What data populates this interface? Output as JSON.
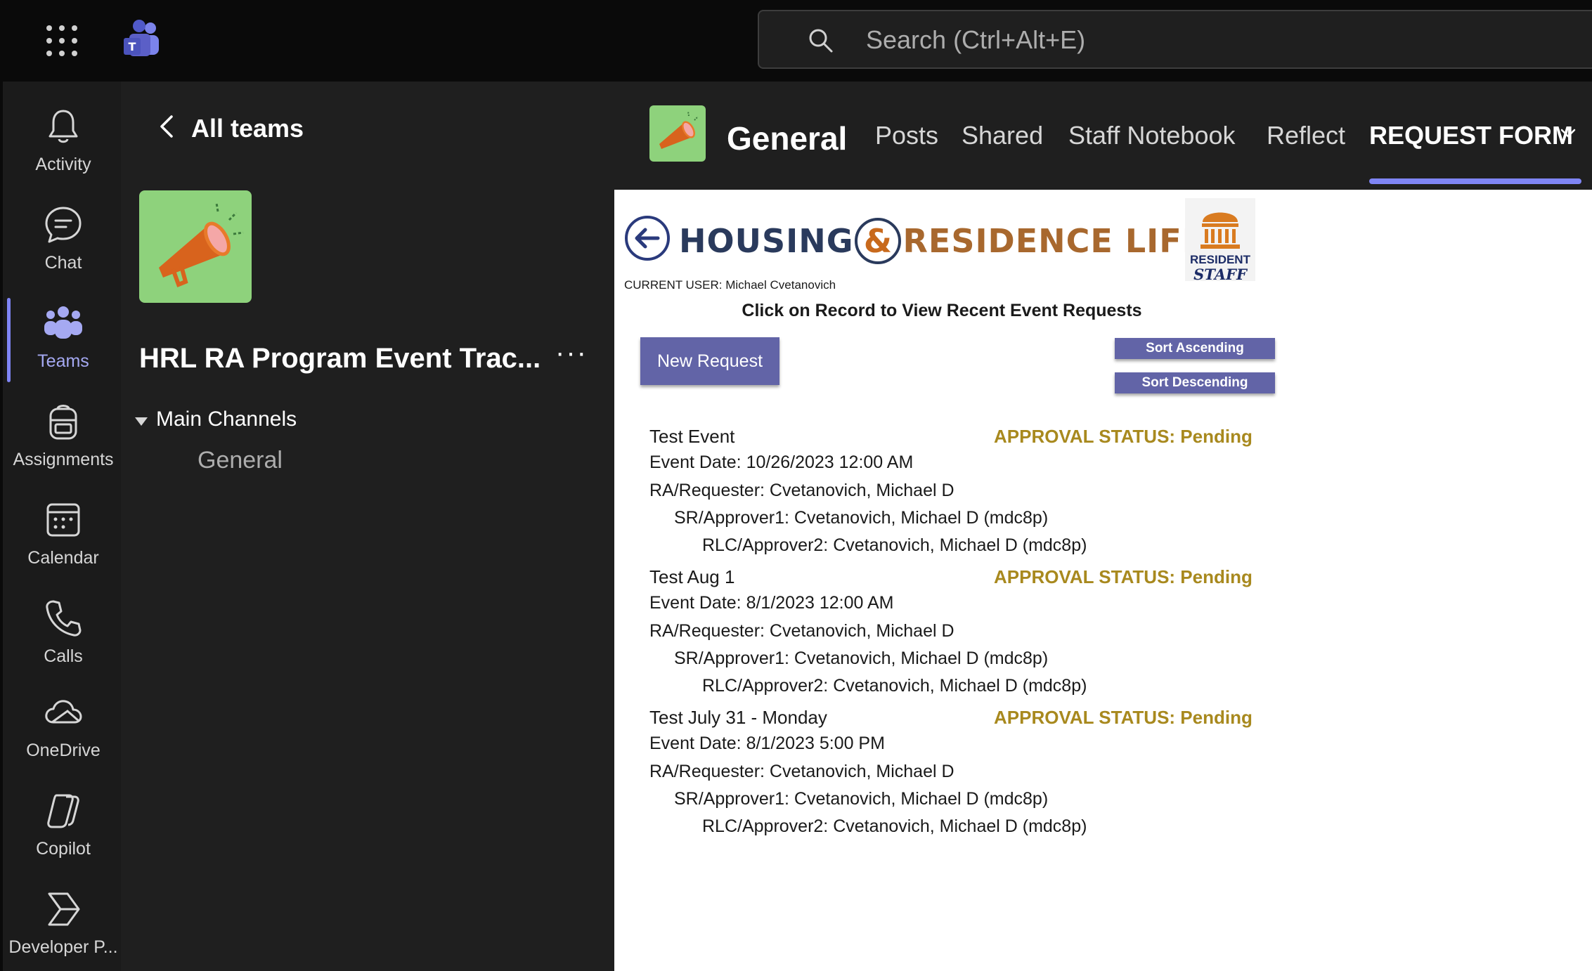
{
  "topbar": {
    "search_placeholder": "Search (Ctrl+Alt+E)"
  },
  "rail": {
    "items": [
      {
        "label": "Activity",
        "icon": "bell-icon"
      },
      {
        "label": "Chat",
        "icon": "chat-icon"
      },
      {
        "label": "Teams",
        "icon": "teams-icon",
        "active": true
      },
      {
        "label": "Assignments",
        "icon": "backpack-icon"
      },
      {
        "label": "Calendar",
        "icon": "calendar-icon"
      },
      {
        "label": "Calls",
        "icon": "phone-icon"
      },
      {
        "label": "OneDrive",
        "icon": "cloud-icon"
      },
      {
        "label": "Copilot",
        "icon": "copilot-icon"
      },
      {
        "label": "Developer P...",
        "icon": "developer-portal-icon"
      }
    ]
  },
  "panel": {
    "back_label": "All teams",
    "team_name": "HRL RA Program Event Trac...",
    "more_label": "···",
    "section_name": "Main Channels",
    "channel": "General"
  },
  "header": {
    "channel_title": "General",
    "tabs": [
      "Posts",
      "Shared",
      "Staff Notebook",
      "Reflect",
      "REQUEST FORM"
    ],
    "active_tab": "REQUEST FORM"
  },
  "app": {
    "banner_part1": "HOUSING",
    "banner_amp": "&",
    "banner_part2": "RESIDENCE LIFE",
    "logo_line1": "RESIDENT",
    "logo_line2": "STAFF",
    "current_user": "CURRENT USER: Michael Cvetanovich",
    "instructions": "Click on Record to View Recent Event Requests",
    "new_request_label": "New Request",
    "sort_ascending_label": "Sort Ascending",
    "sort_descending_label": "Sort Descending",
    "records": [
      {
        "name": "Test Event",
        "status": "APPROVAL STATUS: Pending",
        "event_date": "Event Date: 10/26/2023 12:00 AM",
        "requester": "RA/Requester: Cvetanovich, Michael D",
        "approver1": "SR/Approver1: Cvetanovich, Michael D (mdc8p)",
        "approver2": "RLC/Approver2: Cvetanovich, Michael D (mdc8p)"
      },
      {
        "name": "Test Aug 1",
        "status": "APPROVAL STATUS: Pending",
        "event_date": "Event Date: 8/1/2023 12:00 AM",
        "requester": "RA/Requester: Cvetanovich, Michael D",
        "approver1": "SR/Approver1: Cvetanovich, Michael D (mdc8p)",
        "approver2": "RLC/Approver2: Cvetanovich, Michael D (mdc8p)"
      },
      {
        "name": "Test July 31 - Monday",
        "status": "APPROVAL STATUS: Pending",
        "event_date": "Event Date: 8/1/2023 5:00 PM",
        "requester": "RA/Requester: Cvetanovich, Michael D",
        "approver1": "SR/Approver1: Cvetanovich, Michael D (mdc8p)",
        "approver2": "RLC/Approver2: Cvetanovich, Michael D (mdc8p)"
      }
    ]
  },
  "colors": {
    "accent": "#7f85f5",
    "button": "#6264a7",
    "status": "#a8891e",
    "team_icon_bg": "#8ed27c"
  }
}
